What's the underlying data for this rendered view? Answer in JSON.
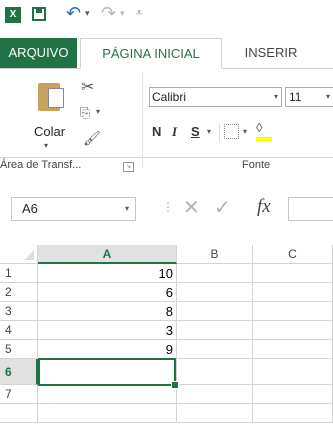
{
  "quick_access": {
    "app_badge": "X",
    "icons": [
      "excel-icon",
      "save-icon",
      "undo-icon",
      "redo-icon",
      "customize-qat-icon"
    ]
  },
  "tabs": [
    {
      "label": "ARQUIVO"
    },
    {
      "label": "PÁGINA INICIAL"
    },
    {
      "label": "INSERIR"
    }
  ],
  "ribbon": {
    "clipboard": {
      "paste_label": "Colar",
      "group_label": "Área de Transf..."
    },
    "font": {
      "font_name": "Calibri",
      "font_size": "11",
      "bold": "N",
      "italic": "I",
      "underline": "S",
      "group_label": "Fonte"
    }
  },
  "formula_bar": {
    "name_box": "A6",
    "fx_label": "fx",
    "formula": ""
  },
  "grid": {
    "columns": [
      "A",
      "B",
      "C"
    ],
    "selected_column": "A",
    "rows": [
      {
        "row": "1",
        "A": "10"
      },
      {
        "row": "2",
        "A": "6"
      },
      {
        "row": "3",
        "A": "8"
      },
      {
        "row": "4",
        "A": "3"
      },
      {
        "row": "5",
        "A": "9"
      },
      {
        "row": "6",
        "A": ""
      },
      {
        "row": "7",
        "A": ""
      }
    ],
    "active_cell": "A6"
  },
  "colors": {
    "excel_green": "#217346",
    "fill_yellow": "#ffff00"
  }
}
